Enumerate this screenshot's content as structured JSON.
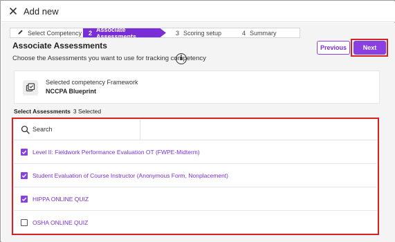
{
  "dialog": {
    "title": "Add new"
  },
  "stepper": {
    "steps": [
      {
        "number": "",
        "label": "Select Competency",
        "state": "completed"
      },
      {
        "number": "2",
        "label": "Associate Assessments",
        "state": "active"
      },
      {
        "number": "3",
        "label": "Scoring setup",
        "state": "upcoming"
      },
      {
        "number": "4",
        "label": "Summary",
        "state": "upcoming"
      }
    ]
  },
  "section": {
    "title": "Associate Assessments",
    "description": "Choose the Assessments you want to use for tracking competency",
    "info_symbol": "i"
  },
  "actions": {
    "previous_label": "Previous",
    "next_label": "Next"
  },
  "framework": {
    "label": "Selected competency Framework",
    "name": "NCCPA Blueprint"
  },
  "assessments": {
    "heading": "Select Assessments",
    "selected_count": "3 Selected",
    "search_placeholder": "Search",
    "items": [
      {
        "label": "Level II: Fieldwork Performance Evaluation OT (FWPE-Midterm)",
        "checked": true
      },
      {
        "label": "Student Evaluation of Course Instructor (Anonymous Form, Nonplacement)",
        "checked": true
      },
      {
        "label": "HIPPA ONLINE QUIZ",
        "checked": true
      },
      {
        "label": "OSHA ONLINE QUIZ",
        "checked": false
      }
    ]
  },
  "colors": {
    "accent": "#8a3fe0",
    "highlight": "#d92020"
  },
  "icons": {
    "close": "close-icon",
    "completed_step": "pencil-icon",
    "info": "info-icon",
    "framework": "framework-icon",
    "search": "search-icon",
    "checkbox": "checkmark-icon"
  }
}
